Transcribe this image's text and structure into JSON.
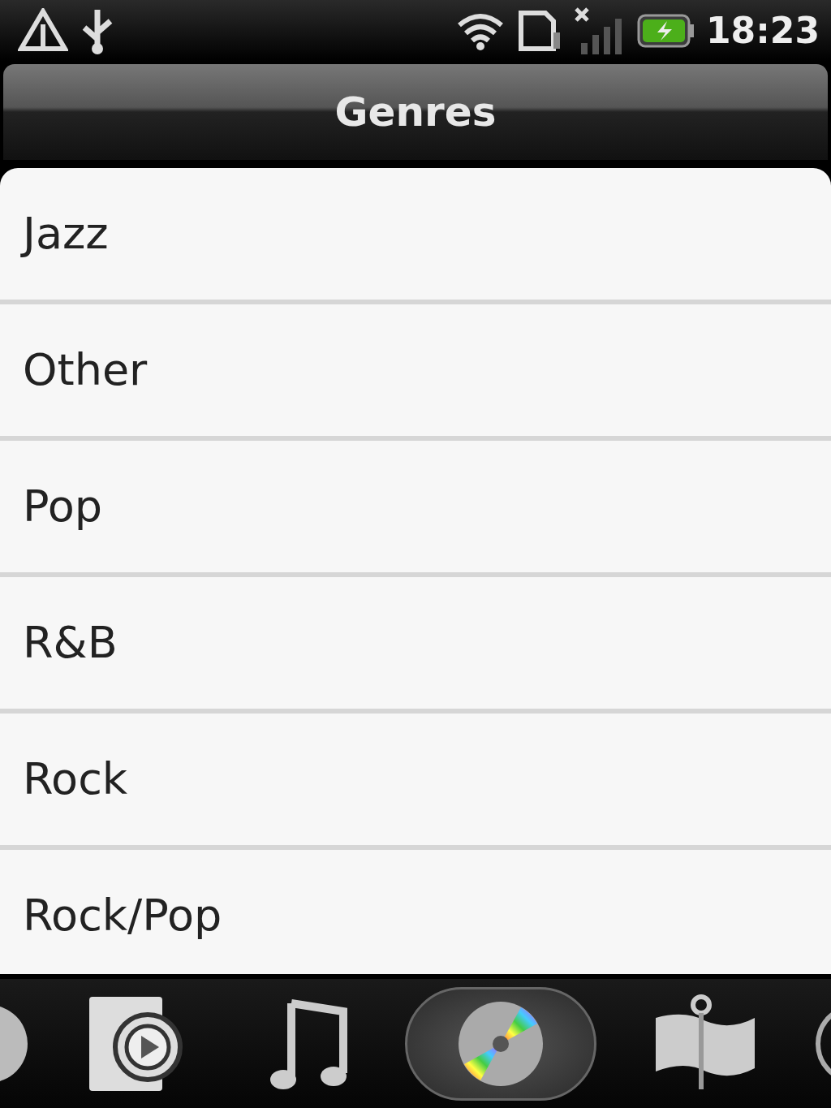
{
  "status_bar": {
    "time": "18:23"
  },
  "title": "Genres",
  "genres": [
    {
      "label": "Jazz"
    },
    {
      "label": "Other"
    },
    {
      "label": "Pop"
    },
    {
      "label": "R&B"
    },
    {
      "label": "Rock"
    },
    {
      "label": "Rock/Pop"
    }
  ],
  "bottom_tabs": [
    {
      "kind": "edge-left",
      "selected": false
    },
    {
      "kind": "playlist",
      "selected": false
    },
    {
      "kind": "songs",
      "selected": false
    },
    {
      "kind": "genres",
      "selected": true
    },
    {
      "kind": "composers",
      "selected": false
    },
    {
      "kind": "edge-right",
      "selected": false
    }
  ]
}
